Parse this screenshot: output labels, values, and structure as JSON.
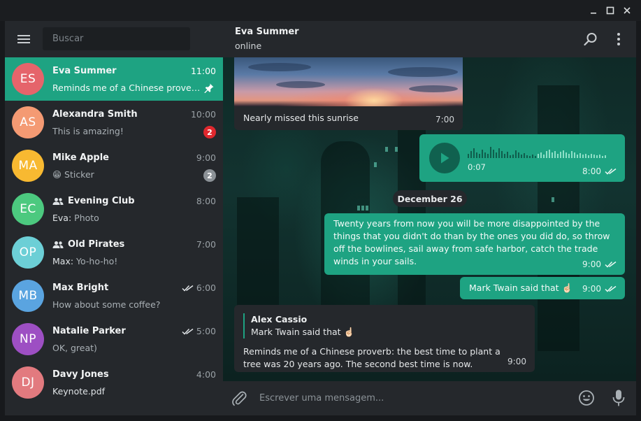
{
  "sidebar": {
    "search_placeholder": "Buscar",
    "chats": [
      {
        "initials": "ES",
        "name": "Eva Summer",
        "time": "11:00",
        "preview": "Reminds me of a Chinese prover…",
        "color": "#e5646b",
        "active": true,
        "pinned": true
      },
      {
        "initials": "AS",
        "name": "Alexandra Smith",
        "time": "10:00",
        "preview": "This is amazing!",
        "color": "#f49a73",
        "badge": "2",
        "badge_color": "red"
      },
      {
        "initials": "MA",
        "name": "Mike Apple",
        "time": "9:00",
        "preview": "😁 Sticker",
        "color": "#f8b931",
        "badge": "2",
        "badge_color": "gray"
      },
      {
        "initials": "EC",
        "name": "Evening Club",
        "time": "8:00",
        "sender": "Eva:",
        "preview": "Photo",
        "color": "#4cc97f",
        "group": true
      },
      {
        "initials": "OP",
        "name": "Old Pirates",
        "time": "7:00",
        "sender": "Max:",
        "preview": "Yo-ho-ho!",
        "color": "#6ccfd6",
        "group": true
      },
      {
        "initials": "MB",
        "name": "Max Bright",
        "time": "6:00",
        "preview": "How about some coffee?",
        "color": "#5aa4e0",
        "read": true
      },
      {
        "initials": "NP",
        "name": "Natalie Parker",
        "time": "5:00",
        "preview": "OK, great)",
        "color": "#9d4fc3",
        "read": true
      },
      {
        "initials": "DJ",
        "name": "Davy Jones",
        "time": "4:00",
        "preview": "Keynote.pdf",
        "color": "#e27a7f"
      }
    ]
  },
  "header": {
    "name": "Eva Summer",
    "status": "online"
  },
  "messages": {
    "photo_caption": "Nearly missed this sunrise",
    "photo_time": "7:00",
    "voice_duration": "0:07",
    "voice_time": "8:00",
    "date_separator": "December 26",
    "out1_text": "Twenty years from now you will be more disappointed by the things that you didn't do than by the ones you did do, so throw off the bowlines, sail away from safe harbor, catch the trade winds in your sails.",
    "out1_time": "9:00",
    "out2_text": "Mark Twain said that ☝🏻",
    "out2_time": "9:00",
    "reply_author": "Alex Cassio",
    "reply_quote": "Mark Twain said that ☝🏻",
    "reply_text": "Reminds me of a Chinese proverb: the best time to plant a tree was 20 years ago. The second best time is now.",
    "reply_time": "9:00"
  },
  "composer": {
    "placeholder": "Escrever uma mensagem..."
  },
  "colors": {
    "accent": "#1ea382",
    "panel": "#25282c",
    "badge_red": "#e0282e"
  }
}
